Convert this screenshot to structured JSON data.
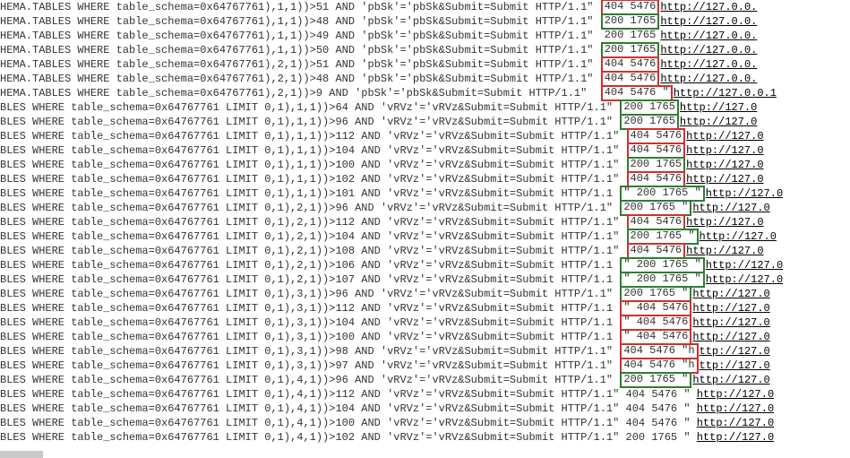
{
  "log_prefixes": {
    "hema_tables": "HEMA.TABLES WHERE table_schema=0x64767761)",
    "bles_where": "BLES WHERE table_schema=0x64767761 LIMIT "
  },
  "rows": [
    {
      "prefix_key": "hema_tables",
      "seg": ",1,1))>51 AND 'pbSk'='pbSk&Submit=Submit HTTP/1.1\"",
      "status_text": "404 5476",
      "box": "red",
      "referer": "http://127.0.0."
    },
    {
      "prefix_key": "hema_tables",
      "seg": ",1,1))>48 AND 'pbSk'='pbSk&Submit=Submit HTTP/1.1\"",
      "status_text": "200 1765",
      "box": "green",
      "referer": "http://127.0.0."
    },
    {
      "prefix_key": "hema_tables",
      "seg": ",1,1))>49 AND 'pbSk'='pbSk&Submit=Submit HTTP/1.1\"",
      "status_text": "200 1765",
      "box": "",
      "referer": "http://127.0.0."
    },
    {
      "prefix_key": "hema_tables",
      "seg": ",1,1))>50 AND 'pbSk'='pbSk&Submit=Submit HTTP/1.1\"",
      "status_text": "200 1765",
      "box": "green",
      "referer": "http://127.0.0."
    },
    {
      "prefix_key": "hema_tables",
      "seg": ",2,1))>51 AND 'pbSk'='pbSk&Submit=Submit HTTP/1.1\"",
      "status_text": "404 5476",
      "box": "red",
      "referer": "http://127.0.0."
    },
    {
      "prefix_key": "hema_tables",
      "seg": ",2,1))>48 AND 'pbSk'='pbSk&Submit=Submit HTTP/1.1\"",
      "status_text": "404 5476",
      "box": "red",
      "referer": "http://127.0.0."
    },
    {
      "prefix_key": "hema_tables",
      "seg": ",2,1))>9 AND 'pbSk'='pbSk&Submit=Submit HTTP/1.1\" ",
      "status_text": "404 5476 \"",
      "box": "red",
      "referer": "http://127.0.0.1"
    },
    {
      "prefix_key": "bles_where",
      "seg": "0,1),1,1))>64 AND 'vRVz'='vRVz&Submit=Submit HTTP/1.1\"",
      "status_text": "200 1765",
      "box": "green",
      "referer": "http://127.0"
    },
    {
      "prefix_key": "bles_where",
      "seg": "0,1),1,1))>96 AND 'vRVz'='vRVz&Submit=Submit HTTP/1.1\"",
      "status_text": "200 1765",
      "box": "green",
      "referer": "http://127.0"
    },
    {
      "prefix_key": "bles_where",
      "seg": "0,1),1,1))>112 AND 'vRVz'='vRVz&Submit=Submit HTTP/1.1\"",
      "status_text": "404 5476",
      "box": "red",
      "referer": "http://127.0"
    },
    {
      "prefix_key": "bles_where",
      "seg": "0,1),1,1))>104 AND 'vRVz'='vRVz&Submit=Submit HTTP/1.1\"",
      "status_text": "404 5476",
      "box": "red",
      "referer": "http://127.0"
    },
    {
      "prefix_key": "bles_where",
      "seg": "0,1),1,1))>100 AND 'vRVz'='vRVz&Submit=Submit HTTP/1.1\"",
      "status_text": "200 1765",
      "box": "green",
      "referer": "http://127.0"
    },
    {
      "prefix_key": "bles_where",
      "seg": "0,1),1,1))>102 AND 'vRVz'='vRVz&Submit=Submit HTTP/1.1\"",
      "status_text": "404 5476",
      "box": "red",
      "referer": "http://127.0"
    },
    {
      "prefix_key": "bles_where",
      "seg": "0,1),1,1))>101 AND 'vRVz'='vRVz&Submit=Submit HTTP/1.1",
      "status_text": "\" 200 1765 \"",
      "box": "green",
      "referer": "http://127.0"
    },
    {
      "prefix_key": "bles_where",
      "seg": "0,1),2,1))>96 AND 'vRVz'='vRVz&Submit=Submit HTTP/1.1\"",
      "status_text": "200 1765 \"",
      "box": "green",
      "referer": "http://127.0"
    },
    {
      "prefix_key": "bles_where",
      "seg": "0,1),2,1))>112 AND 'vRVz'='vRVz&Submit=Submit HTTP/1.1\"",
      "status_text": "404 5476",
      "box": "red",
      "referer": "http://127.0"
    },
    {
      "prefix_key": "bles_where",
      "seg": "0,1),2,1))>104 AND 'vRVz'='vRVz&Submit=Submit HTTP/1.1\"",
      "status_text": "200 1765 \"",
      "box": "green",
      "referer": "http://127.0"
    },
    {
      "prefix_key": "bles_where",
      "seg": "0,1),2,1))>108 AND 'vRVz'='vRVz&Submit=Submit HTTP/1.1\"",
      "status_text": "404 5476",
      "box": "red",
      "referer": "http://127.0"
    },
    {
      "prefix_key": "bles_where",
      "seg": "0,1),2,1))>106 AND 'vRVz'='vRVz&Submit=Submit HTTP/1.1",
      "status_text": "\" 200 1765 \"",
      "box": "green",
      "referer": "http://127.0"
    },
    {
      "prefix_key": "bles_where",
      "seg": "0,1),2,1))>107 AND 'vRVz'='vRVz&Submit=Submit HTTP/1.1",
      "status_text": "\" 200 1765 \"",
      "box": "green",
      "referer": "http://127.0"
    },
    {
      "prefix_key": "bles_where",
      "seg": "0,1),3,1))>96 AND 'vRVz'='vRVz&Submit=Submit HTTP/1.1\"",
      "status_text": "200 1765 \"",
      "box": "green",
      "referer": "http://127.0"
    },
    {
      "prefix_key": "bles_where",
      "seg": "0,1),3,1))>112 AND 'vRVz'='vRVz&Submit=Submit HTTP/1.1",
      "status_text": "\" 404 5476",
      "box": "red",
      "referer": "http://127.0"
    },
    {
      "prefix_key": "bles_where",
      "seg": "0,1),3,1))>104 AND 'vRVz'='vRVz&Submit=Submit HTTP/1.1",
      "status_text": "\" 404 5476",
      "box": "red",
      "referer": "http://127.0"
    },
    {
      "prefix_key": "bles_where",
      "seg": "0,1),3,1))>100 AND 'vRVz'='vRVz&Submit=Submit HTTP/1.1",
      "status_text": "\" 404 5476",
      "box": "red",
      "referer": "http://127.0"
    },
    {
      "prefix_key": "bles_where",
      "seg": "0,1),3,1))>98 AND 'vRVz'='vRVz&Submit=Submit HTTP/1.1\"",
      "status_text": "404 5476 \"h",
      "box": "red",
      "referer": "ttp://127.0"
    },
    {
      "prefix_key": "bles_where",
      "seg": "0,1),3,1))>97 AND 'vRVz'='vRVz&Submit=Submit HTTP/1.1\"",
      "status_text": "404 5476 \"h",
      "box": "red",
      "referer": "ttp://127.0"
    },
    {
      "prefix_key": "bles_where",
      "seg": "0,1),4,1))>96 AND 'vRVz'='vRVz&Submit=Submit HTTP/1.1\"",
      "status_text": "200 1765 \"",
      "box": "green",
      "referer": "http://127.0"
    },
    {
      "prefix_key": "bles_where",
      "seg": "0,1),4,1))>112 AND 'vRVz'='vRVz&Submit=Submit HTTP/1.1\" 404 5476 \"",
      "status_text": "",
      "box": "",
      "referer": "http://127.0"
    },
    {
      "prefix_key": "bles_where",
      "seg": "0,1),4,1))>104 AND 'vRVz'='vRVz&Submit=Submit HTTP/1.1\" 404 5476 \"",
      "status_text": "",
      "box": "",
      "referer": "http://127.0"
    },
    {
      "prefix_key": "bles_where",
      "seg": "0,1),4,1))>100 AND 'vRVz'='vRVz&Submit=Submit HTTP/1.1\" 404 5476 \"",
      "status_text": "",
      "box": "",
      "referer": "http://127.0"
    },
    {
      "prefix_key": "bles_where",
      "seg": "0,1),4,1))>102 AND 'vRVz'='vRVz&Submit=Submit HTTP/1.1\" 200 1765 \"",
      "status_text": "",
      "box": "",
      "referer": "http://127.0"
    }
  ]
}
